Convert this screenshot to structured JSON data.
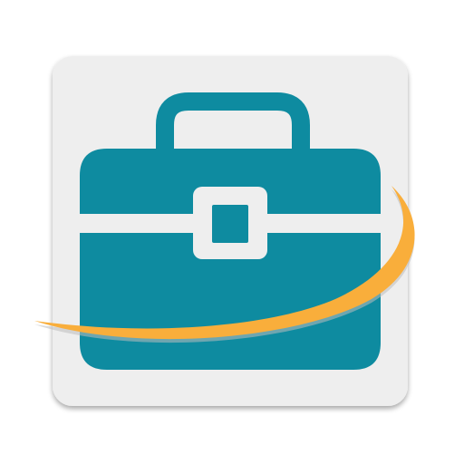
{
  "icon": {
    "semantic_name": "briefcase-app-icon",
    "colors": {
      "background_tile": "#EEEEEE",
      "tile_shadow": "#C9C9C9",
      "briefcase": "#0E8BA0",
      "clasp_frame": "#EEEEEE",
      "swoosh": "#F9AE3B",
      "swoosh_shadow": "#BDBDBD"
    }
  }
}
